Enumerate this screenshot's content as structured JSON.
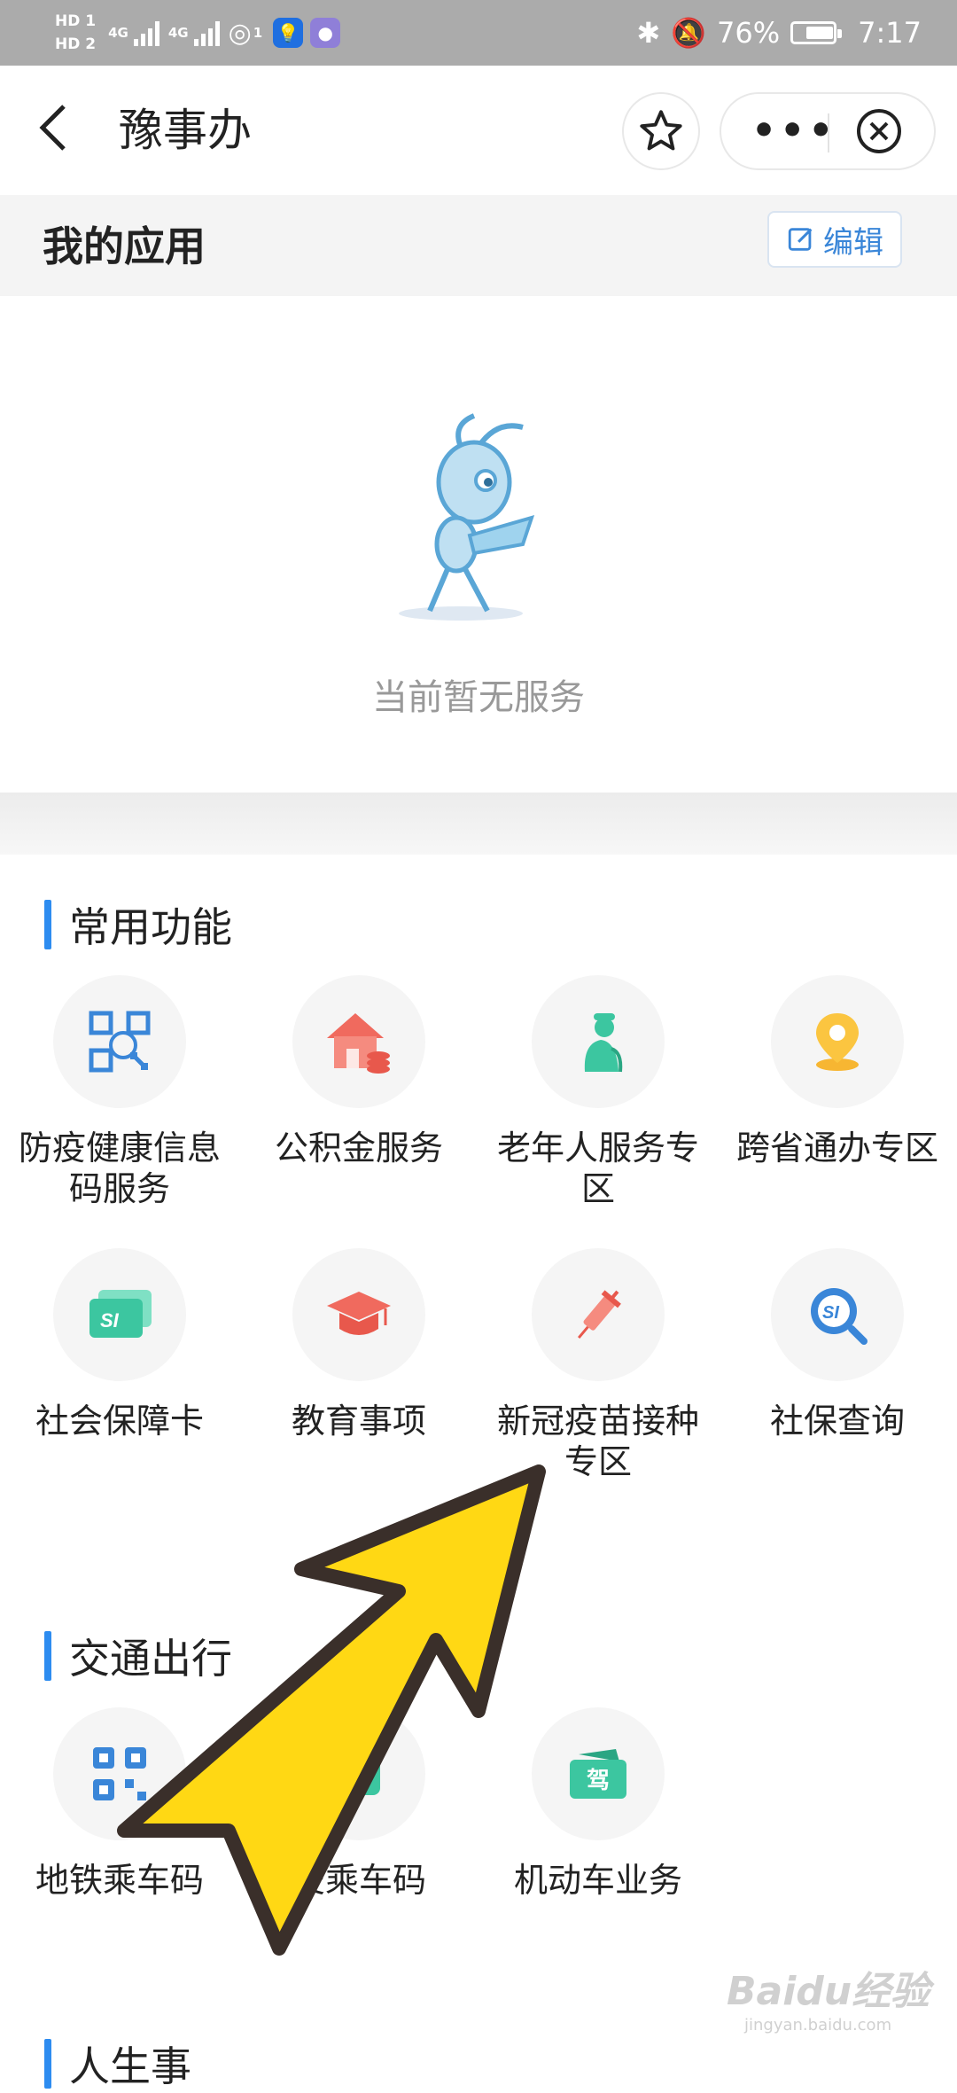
{
  "status_bar": {
    "hd1": "HD 1",
    "hd2": "HD 2",
    "network1": "4G",
    "network2": "4G",
    "hotspot_count": "1",
    "battery_percent": "76%",
    "battery_level": 0.76,
    "time": "7:17"
  },
  "nav": {
    "title": "豫事办",
    "more_label": "•••"
  },
  "my_apps": {
    "title": "我的应用",
    "edit_label": "编辑",
    "empty_text": "当前暂无服务"
  },
  "common_functions": {
    "title": "常用功能",
    "items": [
      {
        "label": "防疫健康信息码服务",
        "icon": "qr-scan-icon"
      },
      {
        "label": "公积金服务",
        "icon": "house-coins-icon"
      },
      {
        "label": "老年人服务专区",
        "icon": "elderly-person-icon"
      },
      {
        "label": "跨省通办专区",
        "icon": "location-pin-icon"
      },
      {
        "label": "社会保障卡",
        "icon": "si-card-icon"
      },
      {
        "label": "教育事项",
        "icon": "graduation-cap-icon"
      },
      {
        "label": "新冠疫苗接种专区",
        "icon": "syringe-icon"
      },
      {
        "label": "社保查询",
        "icon": "si-search-icon"
      }
    ]
  },
  "transport": {
    "title": "交通出行",
    "items": [
      {
        "label": "地铁乘车码",
        "icon": "metro-qr-icon"
      },
      {
        "label": "交乘车码",
        "icon": "bus-code-icon"
      },
      {
        "label": "机动车业务",
        "icon": "driving-license-icon",
        "badge": "驾"
      }
    ]
  },
  "life": {
    "title": "人生事"
  },
  "watermark": {
    "brand": "Baidu经验",
    "url": "jingyan.baidu.com"
  },
  "colors": {
    "accent_blue": "#2d8cf0",
    "arrow_yellow": "#ffd814",
    "arrow_outline": "#3a2f2a"
  }
}
